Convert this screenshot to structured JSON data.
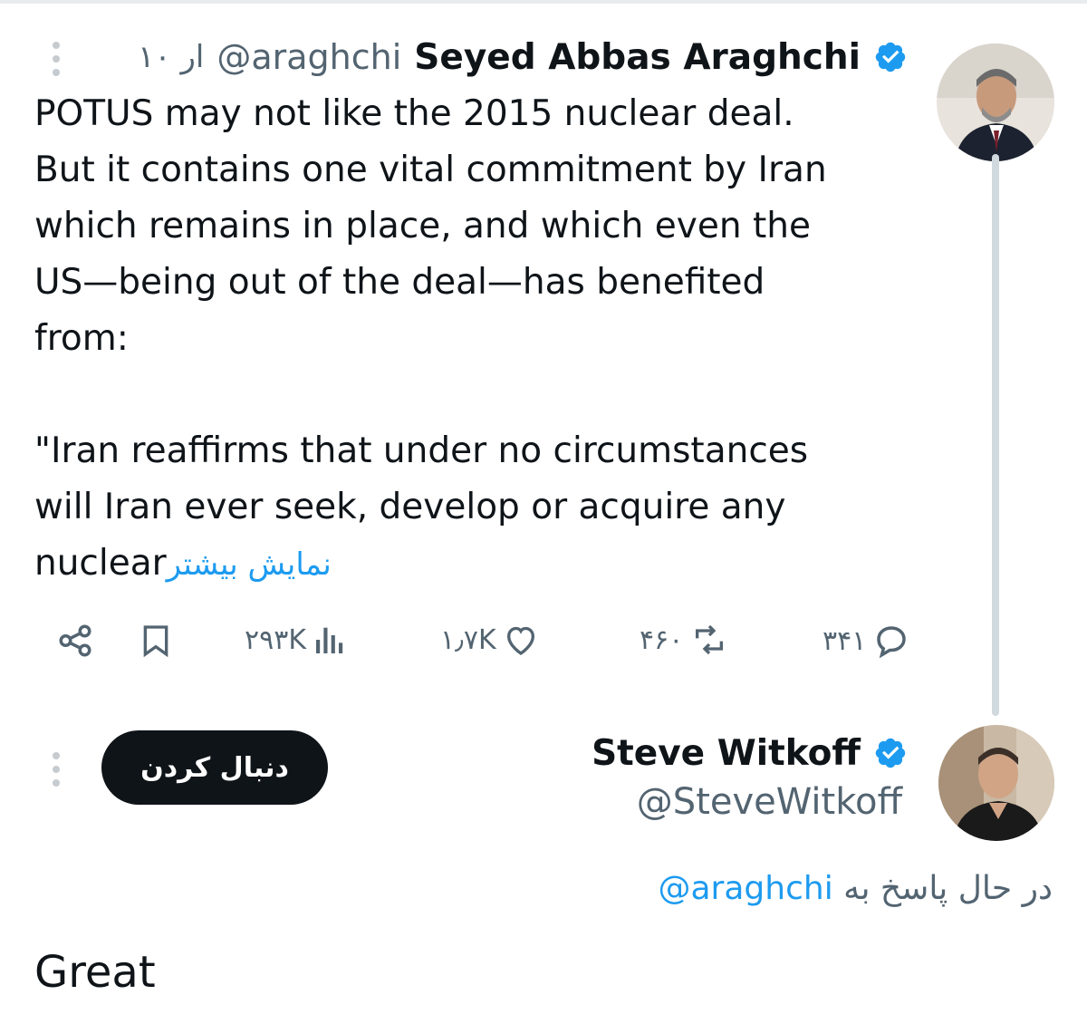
{
  "tweet": {
    "author": {
      "display_name": "Seyed Abbas Araghchi",
      "handle": "@araghchi",
      "time": "۱۰ ار",
      "verified": true
    },
    "text": "POTUS may not like the 2015 nuclear deal.\nBut it contains one vital commitment by Iran\nwhich remains in place, and which even the\nUS—being out of the deal—has benefited\nfrom:\n\n\"Iran reaffirms that under no circumstances\nwill Iran ever seek, develop or acquire any\nnuclear",
    "show_more_label": "نمایش بیشتر",
    "stats": {
      "views": "۲۹۳K",
      "likes": "۱٫۷K",
      "retweets": "۴۶۰",
      "replies": "۳۴۱"
    },
    "icons": {
      "share": "share-icon",
      "bookmark": "bookmark-icon",
      "views": "views-icon",
      "like": "heart-icon",
      "retweet": "retweet-icon",
      "reply": "reply-icon"
    }
  },
  "reply": {
    "author": {
      "display_name": "Steve Witkoff",
      "handle": "@SteveWitkoff",
      "verified": true
    },
    "follow_label": "دنبال کردن",
    "replying_to_prefix": "در حال پاسخ به",
    "replying_to_handle": "@araghchi",
    "text": "Great"
  },
  "colors": {
    "accent": "#1d9bf0",
    "text": "#0f1419",
    "secondary": "#536471",
    "thread_line": "#cfd9de"
  }
}
